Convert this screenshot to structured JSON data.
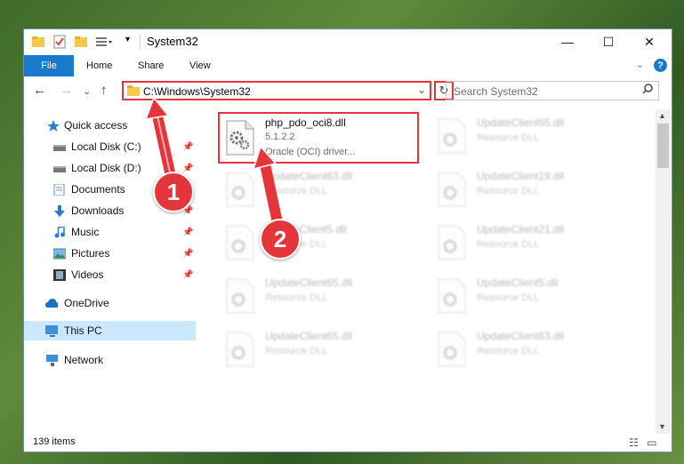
{
  "window": {
    "title": "System32",
    "minimize": "—",
    "maximize": "☐",
    "close": "✕"
  },
  "ribbon": {
    "tabs": [
      "File",
      "Home",
      "Share",
      "View"
    ],
    "expand": "⌄",
    "help": "?"
  },
  "address": {
    "path": "C:\\Windows\\System32",
    "dropdown": "⌄",
    "refresh": "↻"
  },
  "search": {
    "placeholder": "Search System32"
  },
  "nav": {
    "back": "←",
    "forward": "→",
    "recent": "⌄",
    "up": "↑"
  },
  "sidebar": {
    "items": [
      {
        "label": "Quick access",
        "icon": "star-icon"
      },
      {
        "label": "Local Disk (C:)",
        "icon": "drive-icon",
        "pinned": true
      },
      {
        "label": "Local Disk (D:)",
        "icon": "drive-icon",
        "pinned": true
      },
      {
        "label": "Documents",
        "icon": "documents-icon",
        "pinned": true
      },
      {
        "label": "Downloads",
        "icon": "download-icon",
        "pinned": true
      },
      {
        "label": "Music",
        "icon": "music-icon",
        "pinned": true
      },
      {
        "label": "Pictures",
        "icon": "pictures-icon",
        "pinned": true
      },
      {
        "label": "Videos",
        "icon": "videos-icon",
        "pinned": true
      },
      {
        "label": "OneDrive",
        "icon": "cloud-icon"
      },
      {
        "label": "This PC",
        "icon": "computer-icon",
        "selected": true
      },
      {
        "label": "Network",
        "icon": "network-icon"
      }
    ]
  },
  "files": {
    "highlighted": {
      "name": "php_pdo_oci8.dll",
      "version": "5.1.2.2",
      "description": "Oracle (OCI) driver..."
    },
    "left": [
      {
        "name": "UpdateClient63.dll",
        "type": "Resource DLL"
      },
      {
        "name": "UpdateClient5.dll",
        "type": "Resource DLL"
      },
      {
        "name": "UpdateClient65.dll",
        "type": "Resource DLL"
      },
      {
        "name": "UpdateClient65.dll",
        "type": "Resource DLL"
      }
    ],
    "right": [
      {
        "name": "UpdateClient65.dll",
        "type": "Resource DLL"
      },
      {
        "name": "UpdateClient19.dll",
        "type": "Resource DLL"
      },
      {
        "name": "UpdateClient21.dll",
        "type": "Resource DLL"
      },
      {
        "name": "UpdateClient5.dll",
        "type": "Resource DLL"
      },
      {
        "name": "UpdateClient63.dll",
        "type": "Resource DLL"
      }
    ]
  },
  "status": {
    "count": "139 items"
  },
  "annotations": {
    "badge1": "1",
    "badge2": "2",
    "color": "#e3353a"
  }
}
